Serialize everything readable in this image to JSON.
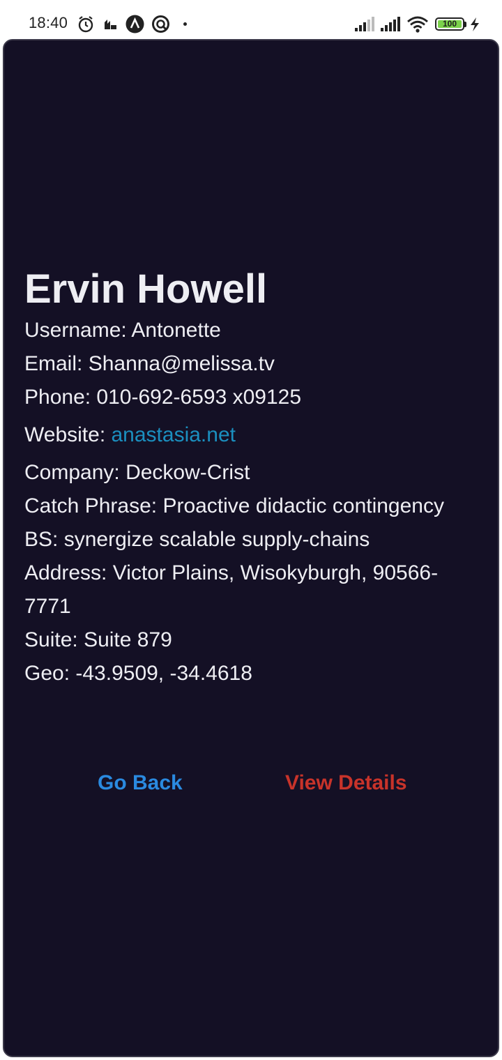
{
  "status_bar": {
    "time": "18:40",
    "battery_level": "100",
    "icons": [
      "alarm-icon",
      "notification-icon",
      "app-a-icon",
      "app-circle-icon",
      "signal-icon",
      "signal-icon",
      "wifi-icon",
      "battery-icon",
      "charging-icon"
    ]
  },
  "profile": {
    "name": "Ervin Howell",
    "username_label": "Username: ",
    "username": "Antonette",
    "email_label": "Email: ",
    "email": "Shanna@melissa.tv",
    "phone_label": "Phone: ",
    "phone": "010-692-6593 x09125",
    "website_label": "Website: ",
    "website": "anastasia.net",
    "company_label": "Company: ",
    "company": "Deckow-Crist",
    "catch_phrase_label": "Catch Phrase: ",
    "catch_phrase": "Proactive didactic contingency",
    "bs_label": "BS: ",
    "bs": "synergize scalable supply-chains",
    "address_label": "Address: ",
    "address": "Victor Plains, Wisokyburgh, 90566-7771",
    "suite_label": "Suite: ",
    "suite": "Suite 879",
    "geo_label": "Geo: ",
    "geo": "-43.9509, -34.4618"
  },
  "actions": {
    "go_back_label": "Go Back",
    "view_details_label": "View Details"
  },
  "colors": {
    "background": "#141025",
    "text": "#eeeef3",
    "link": "#1b8fbf",
    "go_back": "#2a8ae0",
    "view_details": "#c8332a"
  }
}
